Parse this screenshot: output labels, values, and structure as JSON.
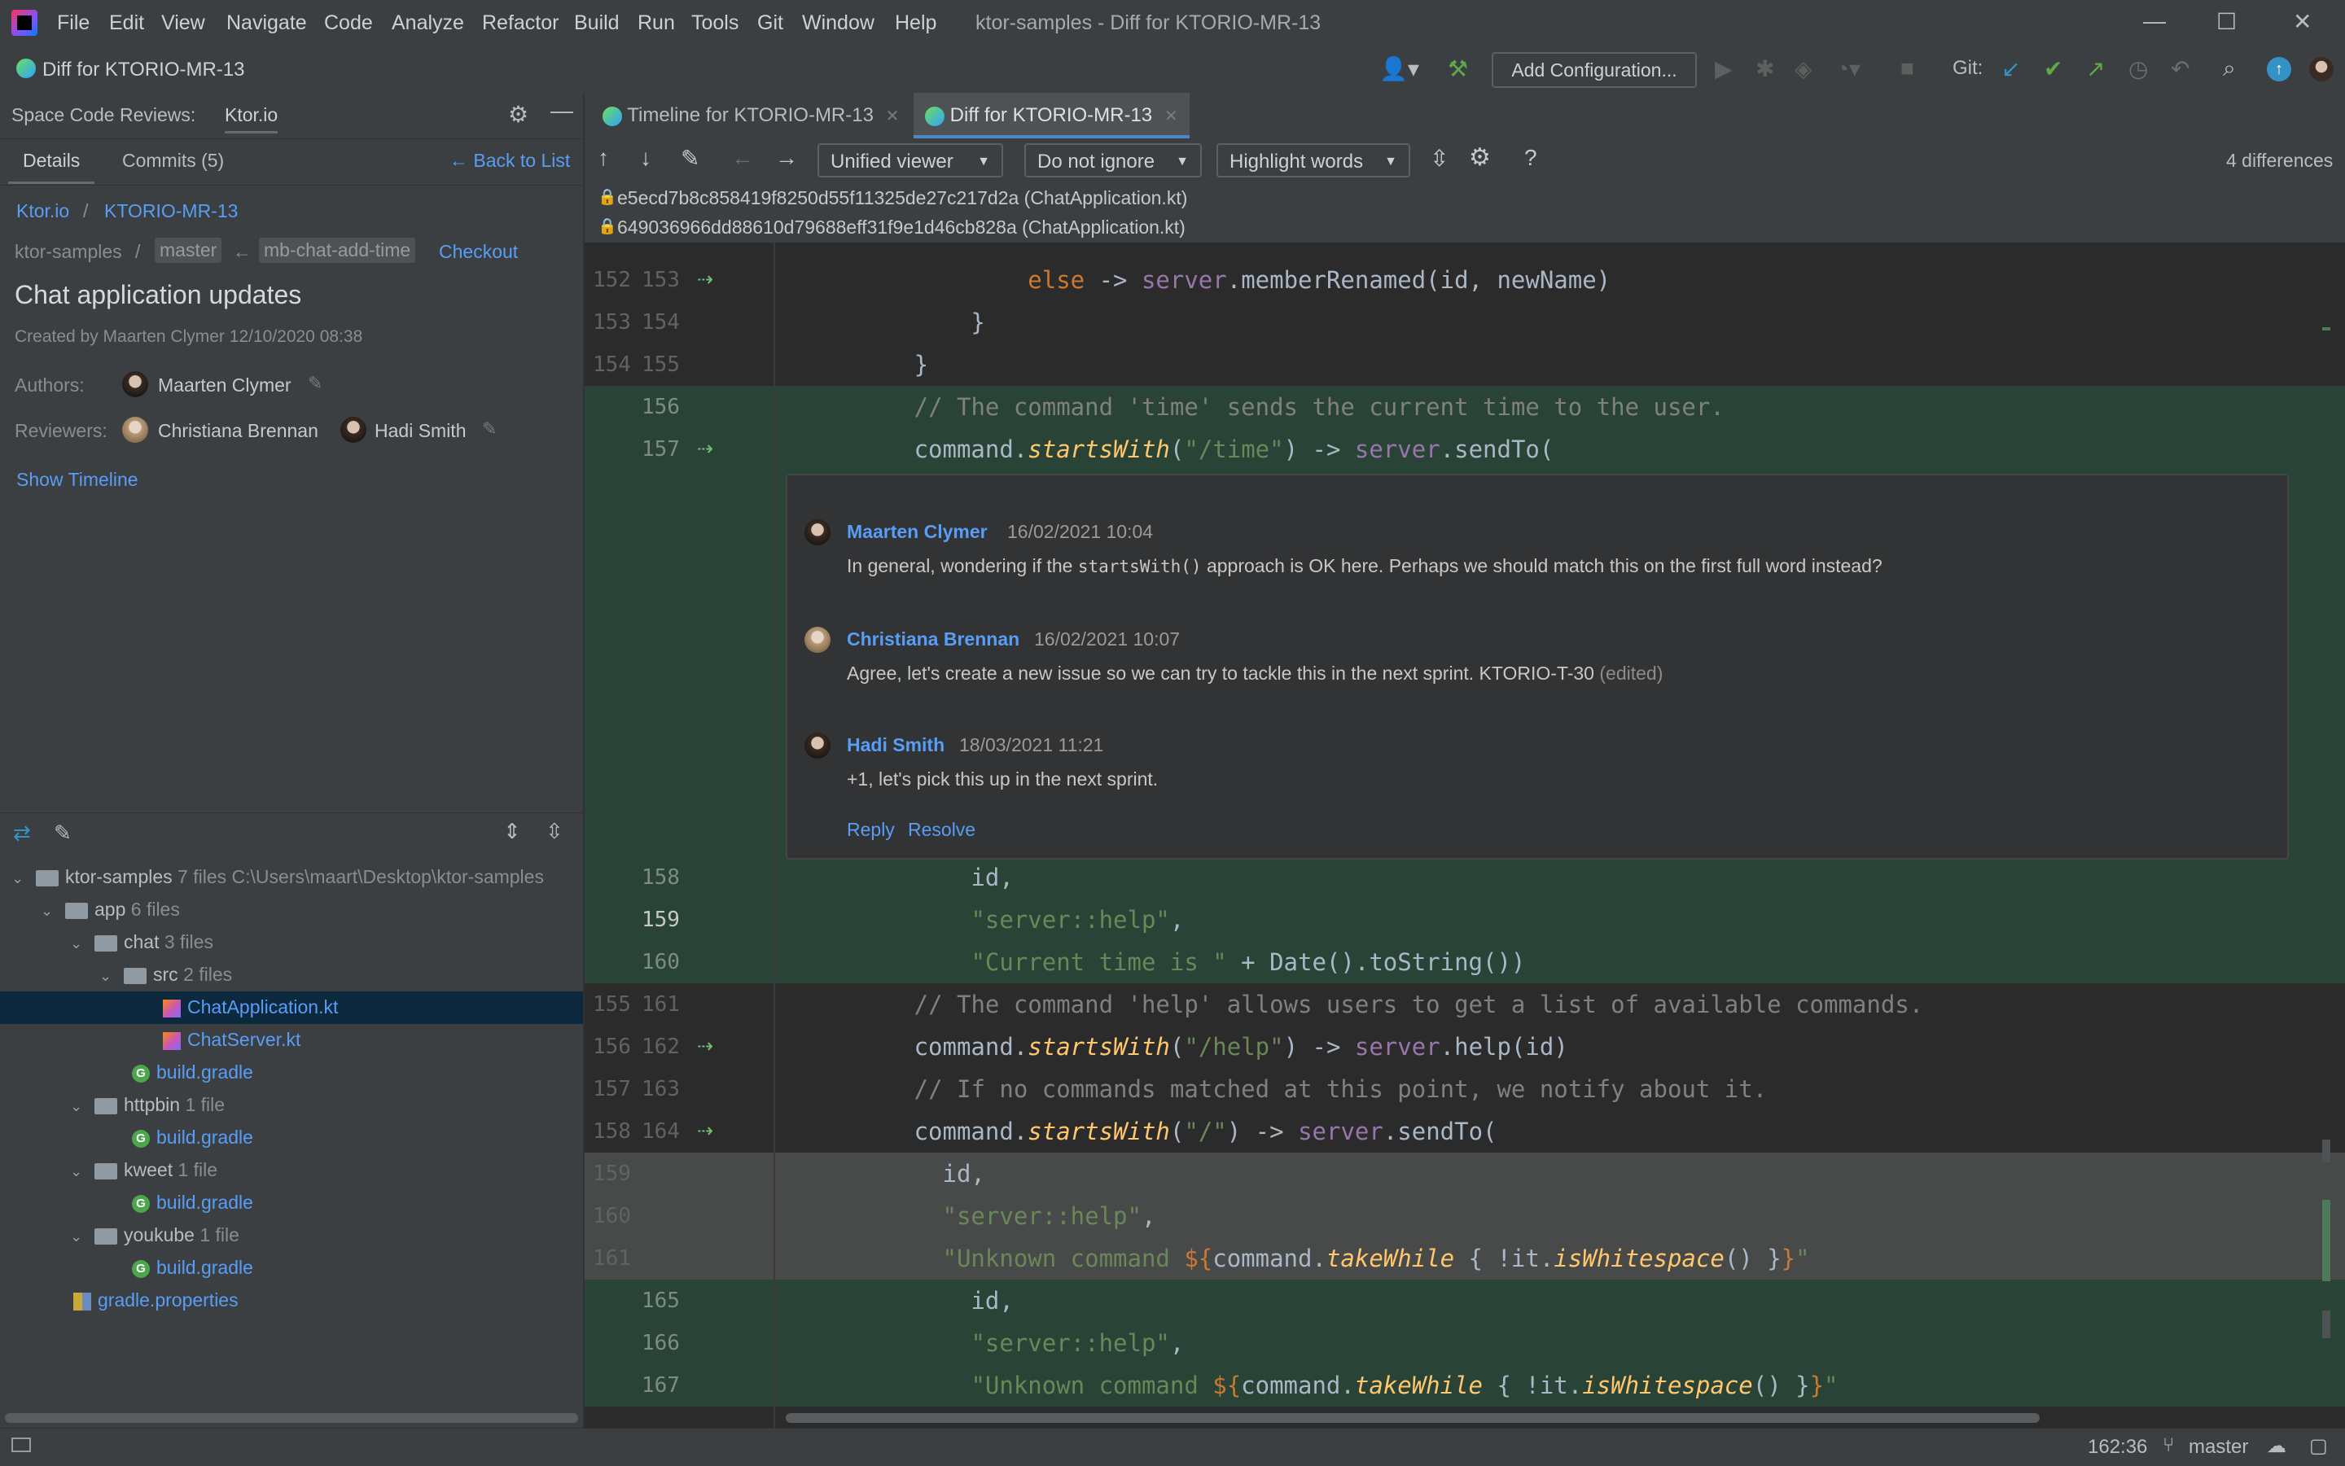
{
  "menu": {
    "items": [
      "File",
      "Edit",
      "View",
      "Navigate",
      "Code",
      "Analyze",
      "Refactor",
      "Build",
      "Run",
      "Tools",
      "Git",
      "Window",
      "Help"
    ],
    "window_title": "ktor-samples - Diff for KTORIO-MR-13"
  },
  "toolbar": {
    "diff_title": "Diff for KTORIO-MR-13",
    "add_configuration": "Add Configuration...",
    "git_label": "Git:"
  },
  "left": {
    "panel_title": "Space Code Reviews:",
    "project_tab": "Ktor.io",
    "tabs": {
      "details": "Details",
      "commits": "Commits (5)"
    },
    "back_link": "← Back to List",
    "breadcrumb": {
      "project": "Ktor.io",
      "sep": "/",
      "mr": "KTORIO-MR-13"
    },
    "branch": {
      "repo": "ktor-samples",
      "sep": "/",
      "target": "master",
      "arrow": "←",
      "source": "mb-chat-add-time",
      "checkout": "Checkout"
    },
    "mr_title": "Chat application updates",
    "created": "Created by Maarten Clymer 12/10/2020 08:38",
    "authors_label": "Authors:",
    "author": "Maarten Clymer",
    "reviewers_label": "Reviewers:",
    "reviewer1": "Christiana Brennan",
    "reviewer2": "Hadi Smith",
    "show_timeline": "Show Timeline"
  },
  "tree": {
    "root": {
      "name": "ktor-samples",
      "count": "7 files",
      "path": "C:\\Users\\maart\\Desktop\\ktor-samples"
    },
    "app": {
      "name": "app",
      "count": "6 files"
    },
    "chat": {
      "name": "chat",
      "count": "3 files"
    },
    "src": {
      "name": "src",
      "count": "2 files"
    },
    "chat_app": "ChatApplication.kt",
    "chat_server": "ChatServer.kt",
    "build_gradle_chat": "build.gradle",
    "httpbin": {
      "name": "httpbin",
      "count": "1 file"
    },
    "build_gradle_httpbin": "build.gradle",
    "kweet": {
      "name": "kweet",
      "count": "1 file"
    },
    "build_gradle_kweet": "build.gradle",
    "youkube": {
      "name": "youkube",
      "count": "1 file"
    },
    "build_gradle_youkube": "build.gradle",
    "gradle_properties": "gradle.properties"
  },
  "tabs": {
    "timeline": "Timeline for KTORIO-MR-13",
    "diff": "Diff for KTORIO-MR-13"
  },
  "diff_toolbar": {
    "viewer": "Unified viewer",
    "ignore": "Do not ignore",
    "highlight": "Highlight words",
    "differences": "4 differences"
  },
  "file_info": {
    "rev1": "e5ecd7b8c858419f8250d55f11325de27c217d2a (ChatApplication.kt)",
    "rev2": "649036966dd88610d79688eff31f9e1d46cb828a (ChatApplication.kt)"
  },
  "code": {
    "l152_left": "152",
    "l152_right": "153",
    "l153_left": "153",
    "l153_right": "154",
    "l154_left": "154",
    "l154_right": "155",
    "l156": "156",
    "l157": "157",
    "l158": "158",
    "l159": "159",
    "l160": "160",
    "l161_left": "155",
    "l161_right": "161",
    "l162_left": "156",
    "l162_right": "162",
    "l163_left": "157",
    "l163_right": "163",
    "l164_left": "158",
    "l164_right": "164",
    "d159": "159",
    "d160": "160",
    "d161": "161",
    "a165": "165",
    "a166": "166",
    "a167": "167"
  },
  "thread": {
    "c1_author": "Maarten Clymer",
    "c1_date": "16/02/2021 10:04",
    "c1_pre": "In general, wondering if the ",
    "c1_code": "startsWith()",
    "c1_post": " approach is OK here. Perhaps we should match this on the first full word instead?",
    "c2_author": "Christiana Brennan",
    "c2_date": "16/02/2021 10:07",
    "c2_body": "Agree, let's create a new issue so we can try to tackle this in the next sprint. KTORIO-T-30",
    "c2_edited": "(edited)",
    "c3_author": "Hadi Smith",
    "c3_date": "18/03/2021 11:21",
    "c3_body": "+1, let's pick this up in the next sprint.",
    "reply": "Reply",
    "resolve": "Resolve"
  },
  "status": {
    "position": "162:36",
    "branch": "master"
  }
}
